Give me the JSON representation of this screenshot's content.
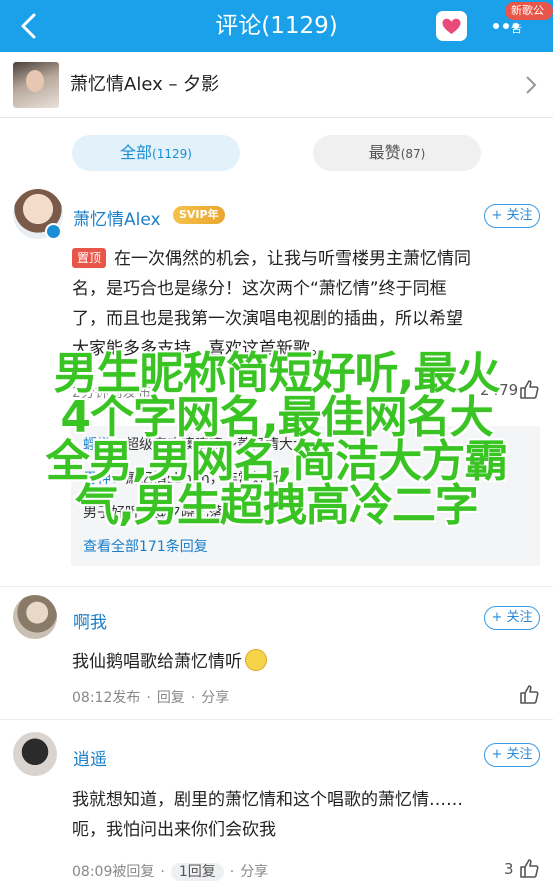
{
  "header": {
    "title": "评论(1129)",
    "badge": "新歌公告",
    "icons": [
      "back-arrow-icon",
      "heart-icon",
      "more-icon"
    ],
    "accent_color": "#1aa1ea"
  },
  "song": {
    "title": "萧忆情Alex – 夕影"
  },
  "tabs": {
    "all_label": "全部",
    "all_count": "(1129)",
    "top_label": "最赞",
    "top_count": "(87)"
  },
  "comments": [
    {
      "username": "萧忆情Alex",
      "vip_badge": "SVIP年",
      "follow": "+ 关注",
      "pin_label": "置顶",
      "lines": [
        "在一次偶然的机会，让我与听雪楼男主萧忆情同",
        "名，是巧合也是缘分！这次两个“萧忆情”终于同框",
        "了，而且也是我第一次演唱电视剧的插曲，所以希望",
        "大家能多多支持，喜欢这首新歌。"
      ],
      "meta_time": "2分钟前发布",
      "like_count": "2479",
      "replies": [
        {
          "name": "蜉蝣：",
          "text": "超级喜欢噢噢噢～萧忆情大大"
        },
        {
          "name": "男神：",
          "text": "萧忆情sbhhh，非常好听"
        },
        {
          "name": "",
          "text": "男子好听～@夕晓忆落花"
        }
      ],
      "view_all": "查看全部171条回复"
    },
    {
      "username": "啊我",
      "follow": "+ 关注",
      "text": "我仙鹅唱歌给萧忆情听",
      "meta_time": "08:12发布",
      "reply_label": "回复",
      "share_label": "分享"
    },
    {
      "username": "逍遥",
      "follow": "+ 关注",
      "lines": [
        "我就想知道，剧里的萧忆情和这个唱歌的萧忆情……",
        "呃，我怕问出来你们会砍我"
      ],
      "meta_time": "08:09被回复",
      "reply_label": "1回复",
      "share_label": "分享",
      "like_count": "3"
    }
  ],
  "overlay_caption": [
    "男生昵称简短好听,最火",
    "4个字网名,最佳网名大",
    "全男,男网名,简洁大方霸",
    "气,男生超拽高冷二字"
  ]
}
